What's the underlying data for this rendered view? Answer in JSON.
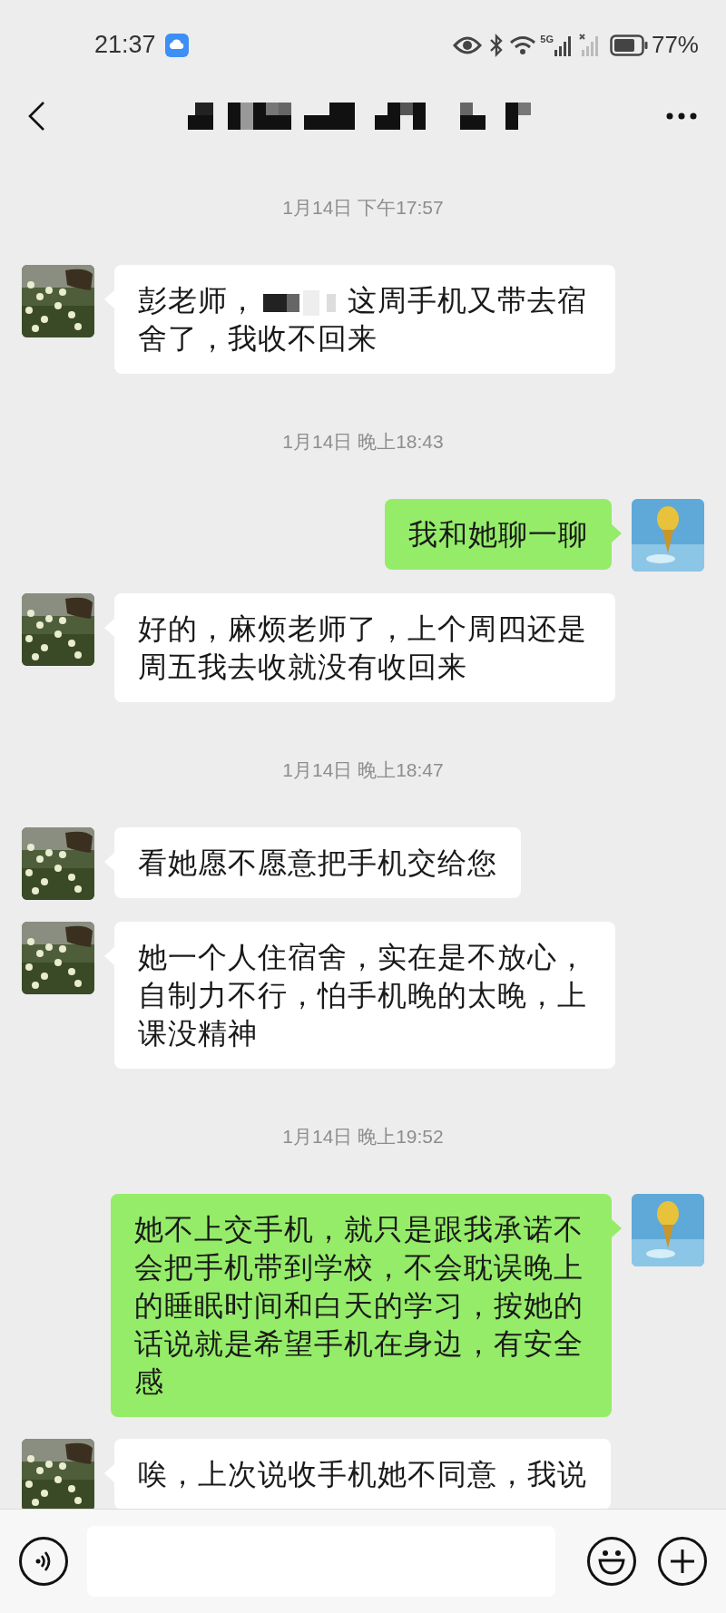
{
  "status_bar": {
    "time": "21:37",
    "network_type": "5G",
    "battery": "77%"
  },
  "header": {
    "title_redacted": true
  },
  "messages": [
    {
      "kind": "time",
      "text": "1月14日 下午17:57"
    },
    {
      "kind": "received",
      "segments": [
        {
          "kind": "text",
          "text": "彭老师，"
        },
        {
          "kind": "redaction"
        },
        {
          "kind": "text",
          "text": "这周手机又带去宿"
        },
        {
          "kind": "text",
          "text": "舍了，我收不回来"
        }
      ]
    },
    {
      "kind": "time",
      "text": "1月14日 晚上18:43"
    },
    {
      "kind": "sent",
      "segments": [
        {
          "kind": "text",
          "text": "我和她聊一聊"
        }
      ]
    },
    {
      "kind": "received",
      "segments": [
        {
          "kind": "text",
          "text": "好的，麻烦老师了，上个周四还是周五我去收就没有收回来"
        }
      ]
    },
    {
      "kind": "time",
      "text": "1月14日 晚上18:47"
    },
    {
      "kind": "received",
      "segments": [
        {
          "kind": "text",
          "text": "看她愿不愿意把手机交给您"
        }
      ]
    },
    {
      "kind": "received",
      "segments": [
        {
          "kind": "text",
          "text": "她一个人住宿舍，实在是不放心，自制力不行，怕手机晚的太晚，上课没精神"
        }
      ]
    },
    {
      "kind": "time",
      "text": "1月14日 晚上19:52"
    },
    {
      "kind": "sent",
      "segments": [
        {
          "kind": "text",
          "text": "她不上交手机，就只是跟我承诺不会把手机带到学校，不会耽误晚上的睡眠时间和白天的学习，按她的话说就是希望手机在身边，有安全感"
        }
      ]
    },
    {
      "kind": "received",
      "segments": [
        {
          "kind": "text",
          "text": "唉，上次说收手机她不同意，我说"
        }
      ]
    }
  ]
}
